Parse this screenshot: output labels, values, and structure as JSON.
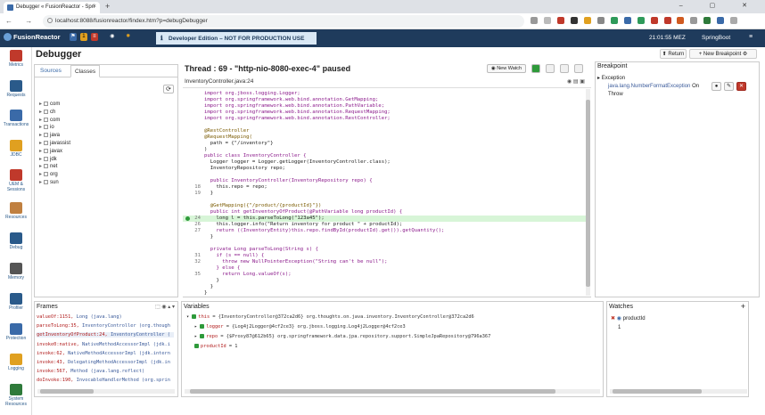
{
  "browser": {
    "tab_title": "Debugger « FusionReactor - Spri",
    "tab_close": "×",
    "new_tab": "+",
    "window_controls": "– ▢ ✕",
    "nav": "← → C",
    "url": "localhost:8088/fusionreactor/findex.htm?p=debugDebugger"
  },
  "app_header": {
    "logo": "FusionReactor",
    "badge_count": "1",
    "notice": "Developer Edition – NOT FOR PRODUCTION USE",
    "time": "21:01:55 MEZ",
    "app_name": "SpringBoot",
    "menu": "≡"
  },
  "left_nav": [
    {
      "label": "Metrics",
      "icon": "chart-icon",
      "color": "#c0392b"
    },
    {
      "label": "Requests",
      "icon": "requests-icon",
      "color": "#2a5a8a"
    },
    {
      "label": "Transactions",
      "icon": "transactions-icon",
      "color": "#3a6aa8"
    },
    {
      "label": "JDBC",
      "icon": "database-icon",
      "color": "#e0a020"
    },
    {
      "label": "UEM & Sessions",
      "icon": "users-icon",
      "color": "#c0392b"
    },
    {
      "label": "Resources",
      "icon": "resources-icon",
      "color": "#c08040"
    },
    {
      "label": "Debug",
      "icon": "debug-icon",
      "color": "#2a5a8a"
    },
    {
      "label": "Memory",
      "icon": "memory-icon",
      "color": "#555555"
    },
    {
      "label": "Profiler",
      "icon": "profiler-icon",
      "color": "#2a5a8a"
    },
    {
      "label": "Protection",
      "icon": "shield-icon",
      "color": "#3a6aa8"
    },
    {
      "label": "Logging",
      "icon": "logging-icon",
      "color": "#e0a020"
    },
    {
      "label": "System Resources",
      "icon": "system-icon",
      "color": "#2e7a3a"
    }
  ],
  "debugger": {
    "title": "Debugger",
    "return_label": "Return",
    "new_bp_label": "New Breakpoint"
  },
  "source_panel": {
    "tabs": [
      "Sources",
      "Classes"
    ],
    "packages": [
      "com",
      "ch",
      "com",
      "io",
      "java",
      "javassist",
      "javax",
      "jdk",
      "net",
      "org",
      "sun"
    ]
  },
  "thread": {
    "title": "Thread : 69 - \"http-nio-8080-exec-4\" paused",
    "new_watch": "New Watch",
    "file": "InventoryController.java:24"
  },
  "code_lines": [
    {
      "n": "",
      "t": "import org.jboss.logging.Logger;"
    },
    {
      "n": "",
      "t": "import org.springframework.web.bind.annotation.GetMapping;"
    },
    {
      "n": "",
      "t": "import org.springframework.web.bind.annotation.PathVariable;"
    },
    {
      "n": "",
      "t": "import org.springframework.web.bind.annotation.RequestMapping;"
    },
    {
      "n": "",
      "t": "import org.springframework.web.bind.annotation.RestController;"
    },
    {
      "n": "",
      "t": ""
    },
    {
      "n": "",
      "t": "@RestController"
    },
    {
      "n": "",
      "t": "@RequestMapping("
    },
    {
      "n": "",
      "t": "  path = {\"/inventory\"}"
    },
    {
      "n": "",
      "t": ")"
    },
    {
      "n": "",
      "t": "public class InventoryController {"
    },
    {
      "n": "",
      "t": "  Logger logger = Logger.getLogger(InventoryController.class);"
    },
    {
      "n": "",
      "t": "  InventoryRepository repo;"
    },
    {
      "n": "",
      "t": ""
    },
    {
      "n": "",
      "t": "  public InventoryController(InventoryRepository repo) {"
    },
    {
      "n": "18",
      "t": "    this.repo = repo;"
    },
    {
      "n": "19",
      "t": "  }"
    },
    {
      "n": "",
      "t": ""
    },
    {
      "n": "",
      "t": "  @GetMapping({\"/product/{productId}\"})"
    },
    {
      "n": "",
      "t": "  public int getInventoryOfProduct(@PathVariable long productId) {"
    },
    {
      "n": "24",
      "t": "    long l = this.parseToLong(\"123a45\");"
    },
    {
      "n": "26",
      "t": "    this.logger.info(\"Return inventory for product \" + productId);"
    },
    {
      "n": "27",
      "t": "    return ((InventoryEntity)this.repo.findById(productId).get()).getQuantity();"
    },
    {
      "n": "",
      "t": "  }"
    },
    {
      "n": "",
      "t": ""
    },
    {
      "n": "",
      "t": "  private Long parseToLong(String s) {"
    },
    {
      "n": "31",
      "t": "    if (s == null) {"
    },
    {
      "n": "32",
      "t": "      throw new NullPointerException(\"String can't be null\");"
    },
    {
      "n": "",
      "t": "    } else {"
    },
    {
      "n": "35",
      "t": "      return Long.valueOf(s);"
    },
    {
      "n": "",
      "t": "    }"
    },
    {
      "n": "",
      "t": "  }"
    },
    {
      "n": "",
      "t": "}"
    }
  ],
  "breakpoint_panel": {
    "title": "Breakpoint",
    "item_type": "Exception",
    "item_name": "java.lang.NumberFormatException",
    "item_suffix": "On",
    "item_action": "Throw"
  },
  "frames_panel": {
    "title": "Frames",
    "rows": [
      {
        "m": "valueOf:1151,",
        "c": "Long (java.lang)"
      },
      {
        "m": "parseToLong:35,",
        "c": "InventoryController (org.though"
      },
      {
        "m": "getInventoryOfProduct:24,",
        "c": "InventoryController ("
      },
      {
        "m": "invoke0:native,",
        "c": "NativeMethodAccessorImpl (jdk.i"
      },
      {
        "m": "invoke:62,",
        "c": "NativeMethodAccessorImpl (jdk.intern"
      },
      {
        "m": "invoke:43,",
        "c": "DelegatingMethodAccessorImpl (jdk.in"
      },
      {
        "m": "invoke:567,",
        "c": "Method (java.lang.reflect)"
      },
      {
        "m": "doInvoke:190,",
        "c": "InvocableHandlerMethod (org.sprin"
      }
    ]
  },
  "vars_panel": {
    "title": "Variables",
    "rows": [
      {
        "name": "this",
        "val": "= {InventoryController@372ca2d6} org.thoughts.on.java.inventory.InventoryController@372ca2d6"
      },
      {
        "name": "logger",
        "val": "= {Log4j2Logger@4cf2ce3} org.jboss.logging.Log4j2Logger@4cf2ce3"
      },
      {
        "name": "repo",
        "val": "= {$Proxy87@612b65} org.springframework.data.jpa.repository.support.SimpleJpaRepository@796a367"
      },
      {
        "name": "productId",
        "val": "= 1"
      }
    ]
  },
  "watch_panel": {
    "title": "Watches",
    "add": "+",
    "item": "productId",
    "value": "1"
  }
}
